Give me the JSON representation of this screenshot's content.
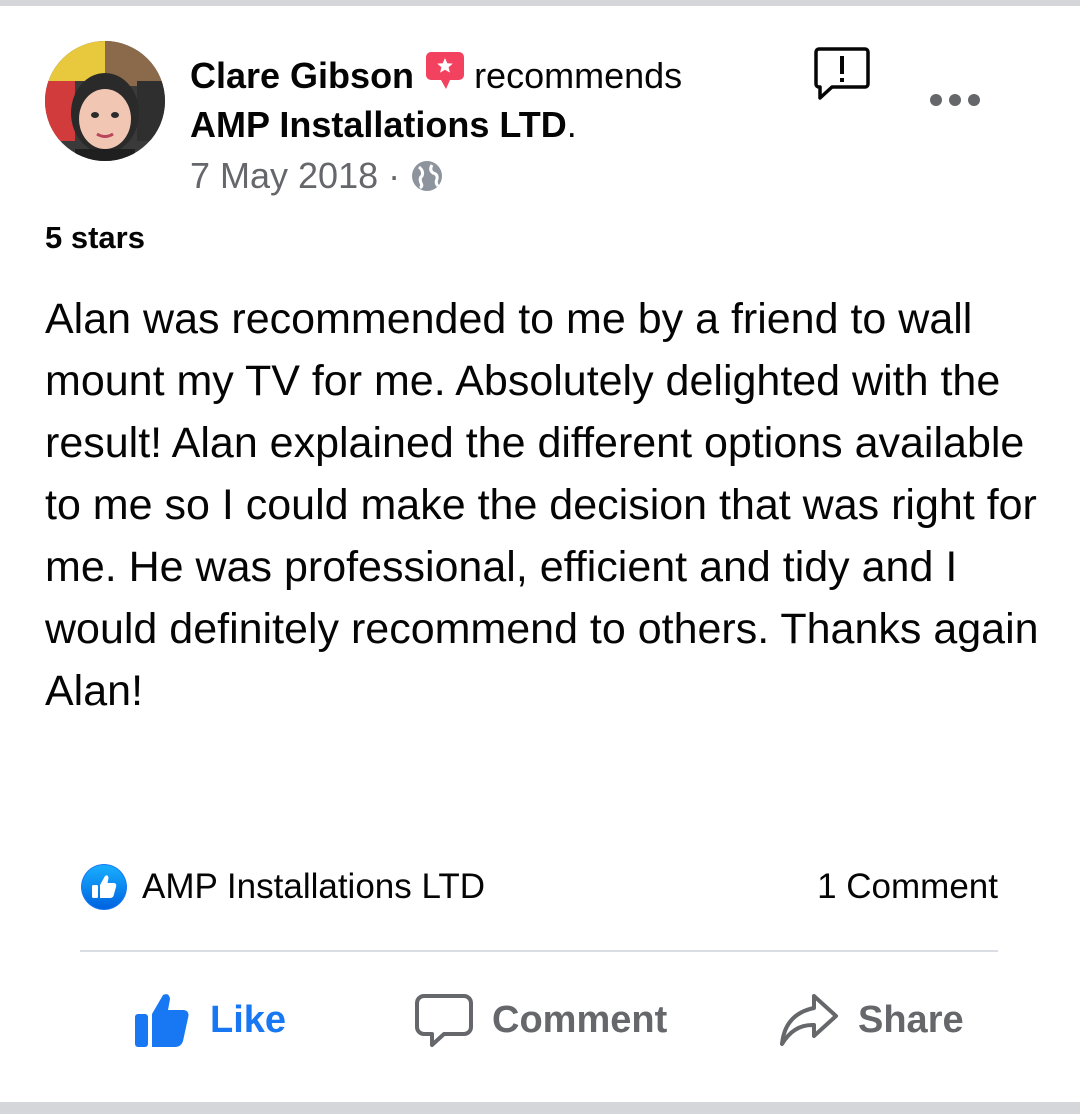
{
  "post": {
    "author": "Clare Gibson",
    "verb": "recommends",
    "page_name": "AMP Installations LTD",
    "page_name_suffix": ".",
    "date": "7 May 2018",
    "separator": "·",
    "audience_icon": "globe-icon",
    "rating_label": "5 stars",
    "review": "Alan was recommended to me by a friend to wall mount my TV for me. Absolutely delighted with the result! Alan explained the different options available to me so I could make the decision that was right for me. He was professional, efficient and tidy and I would definitely recommend to others. Thanks again Alan!"
  },
  "reactions": {
    "icon": "like-reaction-icon",
    "names": "AMP Installations LTD",
    "comment_count": "1 Comment"
  },
  "actions": {
    "like": "Like",
    "comment": "Comment",
    "share": "Share"
  },
  "colors": {
    "primary_text": "#050505",
    "secondary_text": "#65676b",
    "like_blue": "#1877f2",
    "recommend_badge": "#f3425f",
    "divider": "#dadde1"
  }
}
